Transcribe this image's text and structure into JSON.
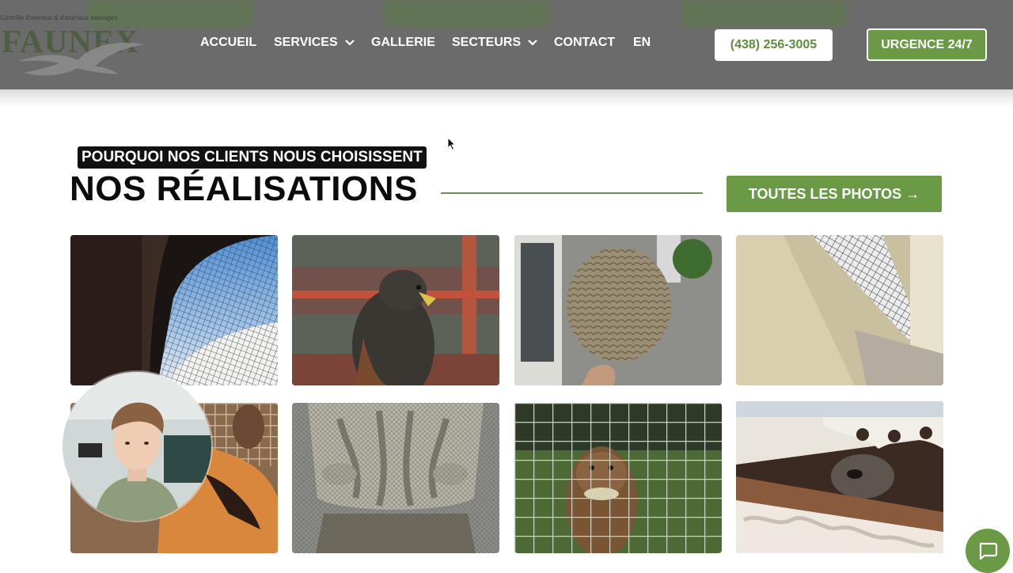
{
  "brand": {
    "name": "FAUNEX",
    "tagline": "Contrôle d'oiseaux & d'animaux sauvages"
  },
  "nav": {
    "items": [
      {
        "label": "ACCUEIL",
        "dropdown": false
      },
      {
        "label": "SERVICES",
        "dropdown": true
      },
      {
        "label": "GALLERIE",
        "dropdown": false
      },
      {
        "label": "SECTEURS",
        "dropdown": true
      },
      {
        "label": "CONTACT",
        "dropdown": false
      },
      {
        "label": "EN",
        "dropdown": false
      }
    ],
    "phone": "(438) 256-3005",
    "urgence": "URGENCE 24/7"
  },
  "section": {
    "kicker": "POURQUOI NOS CLIENTS NOUS CHOISISSENT",
    "title": "NOS RÉALISATIONS",
    "all_photos": "TOUTES LES PHOTOS →"
  },
  "gallery": {
    "items": [
      {
        "subject": "bird-net-balcony"
      },
      {
        "subject": "harris-hawk"
      },
      {
        "subject": "wasp-nest"
      },
      {
        "subject": "wire-mesh-under-eave"
      },
      {
        "subject": "fox-behind-fence"
      },
      {
        "subject": "netted-column-capital"
      },
      {
        "subject": "groundhog-in-cage"
      },
      {
        "subject": "raccoon-under-roof"
      }
    ]
  },
  "colors": {
    "header_bg": "#6b6b6b",
    "brand_green": "#6a9a45",
    "text_dark": "#0c0c0c"
  },
  "icons": {
    "chat": "chat-bubble-icon",
    "dropdown": "chevron-down-icon",
    "arrow": "arrow-right"
  }
}
